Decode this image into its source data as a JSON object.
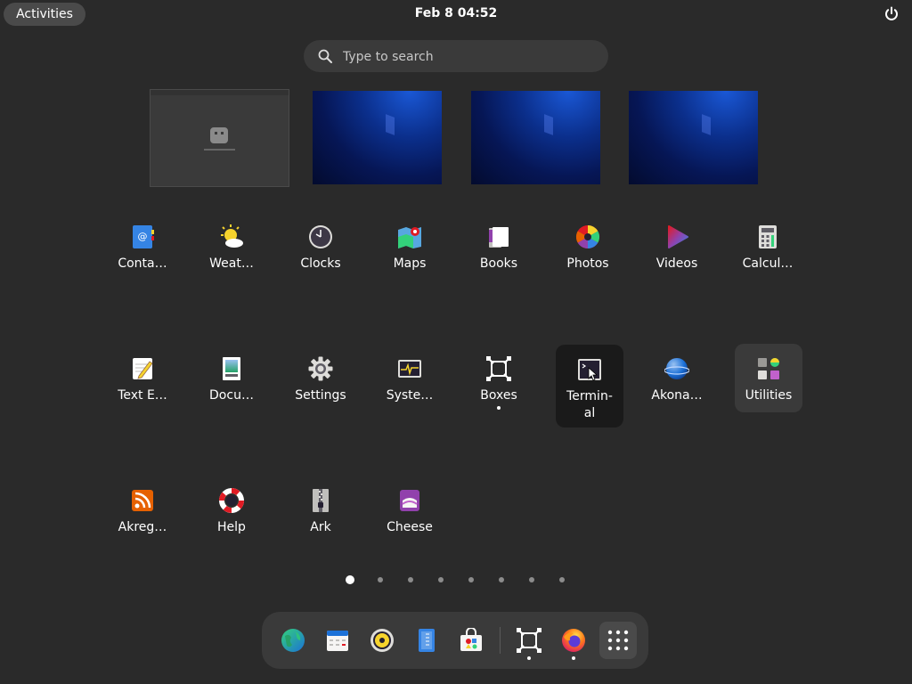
{
  "topbar": {
    "activities_label": "Activities",
    "clock": "Feb 8  04:52",
    "power_icon": "power-icon"
  },
  "search": {
    "placeholder": "Type to search",
    "icon": "search-icon"
  },
  "apps": [
    {
      "label": "Conta…",
      "icon": "contacts-icon"
    },
    {
      "label": "Weat…",
      "icon": "weather-icon"
    },
    {
      "label": "Clocks",
      "icon": "clocks-icon"
    },
    {
      "label": "Maps",
      "icon": "maps-icon"
    },
    {
      "label": "Books",
      "icon": "books-icon"
    },
    {
      "label": "Photos",
      "icon": "photos-icon"
    },
    {
      "label": "Videos",
      "icon": "videos-icon"
    },
    {
      "label": "Calcul…",
      "icon": "calculator-icon"
    },
    {
      "label": "Text E…",
      "icon": "text-editor-icon"
    },
    {
      "label": "Docu…",
      "icon": "document-viewer-icon"
    },
    {
      "label": "Settings",
      "icon": "settings-gear-icon"
    },
    {
      "label": "Syste…",
      "icon": "system-monitor-icon"
    },
    {
      "label": "Boxes",
      "icon": "boxes-icon",
      "running": true
    },
    {
      "label": "Termin-\nal",
      "icon": "terminal-icon",
      "highlighted": true
    },
    {
      "label": "Akona…",
      "icon": "akonadi-icon"
    },
    {
      "label": "Utilities",
      "icon": "utilities-folder-icon",
      "folder": true
    },
    {
      "label": "Akreg…",
      "icon": "akregator-rss-icon"
    },
    {
      "label": "Help",
      "icon": "help-lifebuoy-icon"
    },
    {
      "label": "Ark",
      "icon": "ark-archive-icon"
    },
    {
      "label": "Cheese",
      "icon": "cheese-camera-icon"
    }
  ],
  "pages": {
    "count": 8,
    "current": 1
  },
  "dash": [
    {
      "name": "web-browser",
      "icon": "globe-icon"
    },
    {
      "name": "calendar",
      "icon": "calendar-icon"
    },
    {
      "name": "rhythmbox",
      "icon": "music-player-icon"
    },
    {
      "name": "text-editor",
      "icon": "notes-icon"
    },
    {
      "name": "software",
      "icon": "software-store-icon"
    },
    {
      "name": "boxes",
      "icon": "boxes-icon",
      "running": true
    },
    {
      "name": "firefox",
      "icon": "firefox-icon",
      "running": true
    },
    {
      "name": "show-apps",
      "icon": "app-grid-icon"
    }
  ],
  "colors": {
    "background": "#2a2a2a",
    "panel": "#3a3a3a",
    "accent_blue": "#1a58d6"
  }
}
